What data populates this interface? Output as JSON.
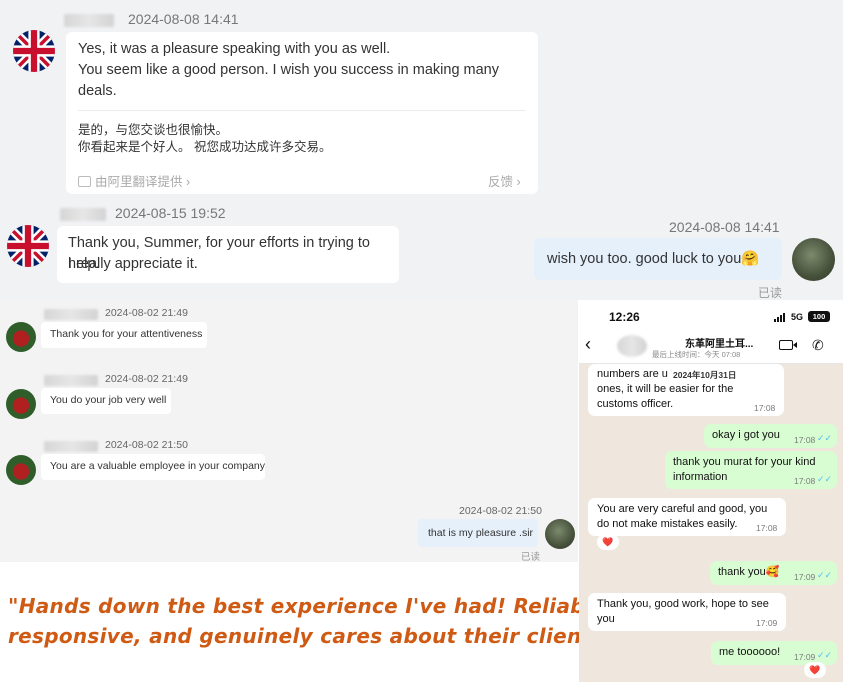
{
  "top_chat": {
    "msg1": {
      "timestamp": "2024-08-08 14:41",
      "lines": [
        "Yes, it was a pleasure speaking with you as well.",
        "You seem like a good person. I wish you success in making many",
        "deals."
      ],
      "translation_lines": [
        "是的，与您交谈也很愉快。",
        "你看起来是个好人。 祝您成功达成许多交易。"
      ],
      "translation_source": "由阿里翻译提供",
      "feedback": "反馈"
    },
    "msg2": {
      "timestamp": "2024-08-15 19:52",
      "lines": [
        "Thank you, Summer, for your efforts in trying to help.",
        "I really appreciate it."
      ]
    },
    "reply": {
      "timestamp": "2024-08-08 14:41",
      "text": "wish you too. good luck to you",
      "emoji": "🤗",
      "status": "已读"
    }
  },
  "mid_chat": {
    "messages": [
      {
        "timestamp": "2024-08-02 21:49",
        "text": "Thank you for your attentiveness"
      },
      {
        "timestamp": "2024-08-02 21:49",
        "text": "You do your job very well"
      },
      {
        "timestamp": "2024-08-02 21:50",
        "text": "You are a valuable employee in your company"
      }
    ],
    "reply": {
      "timestamp": "2024-08-02 21:50",
      "text": "that is my pleasure .sir",
      "status": "已读"
    }
  },
  "quote": {
    "line1": "\"Hands down the best experience I've had! Reliable,",
    "line2": "responsive, and genuinely cares about their clients.\""
  },
  "whatsapp": {
    "time": "12:26",
    "network": "5G",
    "battery": "100",
    "contact_name": "东革阿里土耳...",
    "last_seen_label": "最后上线时间：",
    "last_seen": "今天 07:08",
    "date_chip": "2024年10月31日",
    "partial_top": "numbers are u",
    "msg_first": {
      "lines": [
        "ones, it will be easier for the",
        "customs officer."
      ],
      "time": "17:08"
    },
    "messages": [
      {
        "dir": "out",
        "lines": [
          "okay i got you"
        ],
        "time": "17:08"
      },
      {
        "dir": "out",
        "lines": [
          "thank you murat for your kind",
          "information"
        ],
        "time": "17:08"
      },
      {
        "dir": "in",
        "lines": [
          "You are very careful and good, you",
          "do not make mistakes easily."
        ],
        "time": "17:08",
        "reaction": "❤️"
      },
      {
        "dir": "out",
        "lines": [
          "thank you🥰"
        ],
        "time": "17:09"
      },
      {
        "dir": "in",
        "lines": [
          "Thank you, good work, hope to see",
          "you"
        ],
        "time": "17:09"
      },
      {
        "dir": "out",
        "lines": [
          "me toooooo!"
        ],
        "time": "17:09",
        "reaction": "❤️"
      }
    ]
  }
}
